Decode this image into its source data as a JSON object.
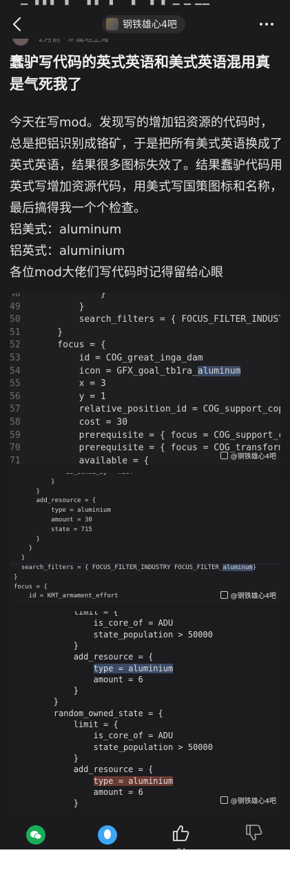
{
  "status_bar": {
    "text": "▁ ▚ ▖▖ ▗ ▘  ▗ ▖ ▗ ▘ ▚ ▘  ▖ ▖ ▁ ▁ ▁▁"
  },
  "nav": {
    "forum_name": "钢铁雄心4吧"
  },
  "author": {
    "meta": "2月前 · IP属地上海"
  },
  "post": {
    "title": "蠢驴写代码的英式英语和美式英语混用真是气死我了",
    "paragraphs": [
      "今天在写mod。发现写的增加铝资源的代码时，总是把铝识别成铬矿，于是把所有美式英语换成了英式英语，结果很多图标失效了。结果蠢驴代码用英式写增加资源代码，用美式写国策图标和名称，最后搞得我一个个检查。",
      "铝美式：aluminum",
      "铝英式：aluminium",
      "各位mod大佬们写代码时记得留给心眼"
    ]
  },
  "code1": {
    "lines": [
      {
        "n": "48",
        "code": "            }"
      },
      {
        "n": "49",
        "code": "        }"
      },
      {
        "n": "50",
        "code": "        search_filters = { FOCUS_FILTER_INDUSTRY"
      },
      {
        "n": "51",
        "code": "    }"
      },
      {
        "n": "52",
        "code": "    focus = {"
      },
      {
        "n": "53",
        "code": "        id = COG_great_inga_dam"
      },
      {
        "n": "54",
        "pre": "        icon = GFX_goal_tb1ra_",
        "hl": "aluminum"
      },
      {
        "n": "55",
        "code": "        x = 3"
      },
      {
        "n": "56",
        "code": "        y = 1"
      },
      {
        "n": "57",
        "code": "        relative_position_id = COG_support_copper"
      },
      {
        "n": "58",
        "code": "        cost = 30"
      },
      {
        "n": "59",
        "code": "        prerequisite = { focus = COG_support_copp"
      },
      {
        "n": "70",
        "code": "        prerequisite = { focus = COG_transform_th"
      },
      {
        "n": "71",
        "code": "        available = {"
      }
    ],
    "watermark": "@钢铁雄心4吧"
  },
  "code2": {
    "lines": [
      {
        "code": "              is_owned_by = ROOT"
      },
      {
        "code": "          }"
      },
      {
        "code": "      }"
      },
      {
        "code": "      add_resource = {"
      },
      {
        "code": "          type = aluminium"
      },
      {
        "code": "          amount = 30"
      },
      {
        "code": "          state = 715"
      },
      {
        "code": "      }"
      },
      {
        "code": "    }"
      },
      {
        "code": "  }"
      },
      {
        "pre": "  search_filters = { FOCUS_FILTER_INDUSTRY FOCUS_FILTER_",
        "hl": "aluminum",
        "post": "}"
      },
      {
        "code": "}"
      },
      {
        "code": "focus = {"
      },
      {
        "code": "    id = KMT_armament_effort"
      }
    ],
    "watermark": "@钢铁雄心4吧"
  },
  "code3": {
    "lines": [
      {
        "code": "            limit = {"
      },
      {
        "code": "                is_core_of = ADU"
      },
      {
        "code": "                state_population > 50000"
      },
      {
        "code": "            }"
      },
      {
        "code": "            add_resource = {"
      },
      {
        "pre": "                ",
        "hl": "type = aluminium",
        "hlc": "blue"
      },
      {
        "code": "                amount = 6"
      },
      {
        "code": "            }"
      },
      {
        "code": "        }"
      },
      {
        "code": "        random_owned_state = {"
      },
      {
        "code": "            limit = {"
      },
      {
        "code": "                is_core_of = ADU"
      },
      {
        "code": "                state_population > 50000"
      },
      {
        "code": "            }"
      },
      {
        "code": "            add_resource = {"
      },
      {
        "pre": "                ",
        "hl": "type = aluminium",
        "hlc": "red"
      },
      {
        "code": "                amount = 6"
      },
      {
        "code": "            }"
      }
    ],
    "watermark": "@钢铁雄心4吧"
  },
  "bottom_bar": {
    "actions": [
      {
        "name": "share-wechat",
        "icon": "wechat-icon"
      },
      {
        "name": "share-qq",
        "icon": "qq-icon"
      },
      {
        "name": "like",
        "icon": "thumb-up-icon",
        "count": "84"
      },
      {
        "name": "dislike",
        "icon": "thumb-down-icon"
      }
    ]
  },
  "colors": {
    "background": "#1b1b1d",
    "highlight_blue": "#3a4a66",
    "highlight_red": "#6a3a32",
    "wechat_green": "#1aad5a",
    "qq_blue": "#3da6f5"
  }
}
